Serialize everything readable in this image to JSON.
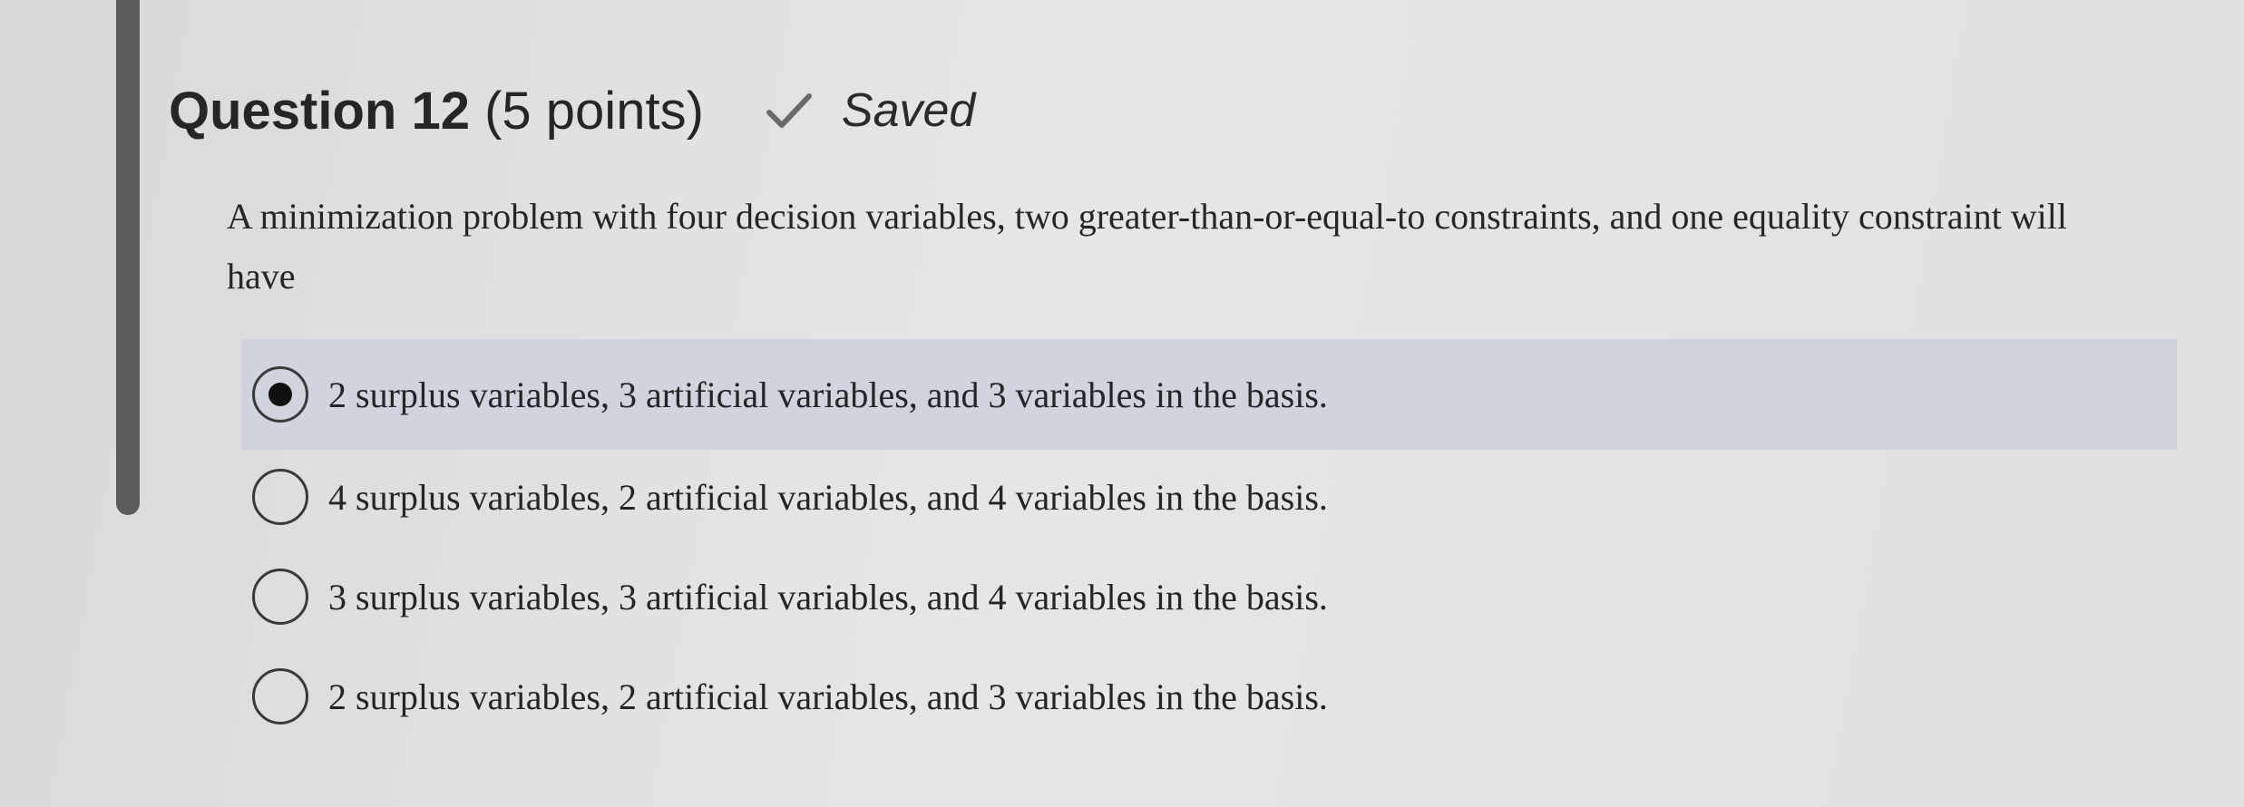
{
  "header": {
    "question_number": "Question 12",
    "points": "(5 points)",
    "status": "Saved",
    "status_icon": "check-icon"
  },
  "question": {
    "text": "A minimization problem with four decision variables, two greater-than-or-equal-to constraints, and one equality constraint will have"
  },
  "options": [
    {
      "label": "2 surplus variables, 3 artificial variables, and 3 variables in the basis.",
      "selected": true
    },
    {
      "label": "4 surplus variables, 2 artificial variables, and 4 variables in the basis.",
      "selected": false
    },
    {
      "label": "3 surplus variables, 3 artificial variables, and 4 variables in the basis.",
      "selected": false
    },
    {
      "label": "2 surplus variables, 2 artificial variables, and 3 variables in the basis.",
      "selected": false
    }
  ],
  "colors": {
    "selected_row": "#d0d4de",
    "left_bar": "#5c5c5c",
    "background": "#e2e2e2"
  }
}
